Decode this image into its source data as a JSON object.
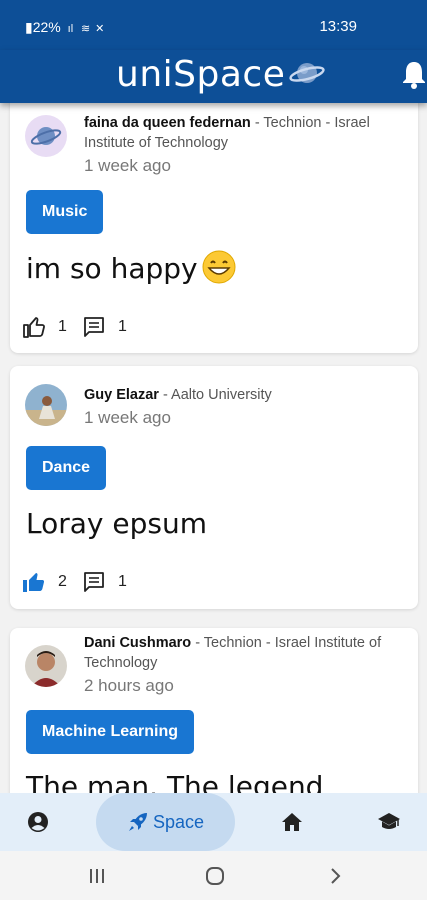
{
  "status": {
    "battery": "22%",
    "time": "13:39"
  },
  "header": {
    "title": "uniSpace"
  },
  "posts": [
    {
      "author": "faina da queen federnan",
      "affiliation": " - Technion - Israel Institute of Technology",
      "time": "1 week ago",
      "tag": "Music",
      "text": "im so happy",
      "likes": "1",
      "comments": "1",
      "liked": false
    },
    {
      "author": "Guy Elazar",
      "affiliation": " - Aalto University",
      "time": "1 week ago",
      "tag": "Dance",
      "text": "Loray epsum",
      "likes": "2",
      "comments": "1",
      "liked": true
    },
    {
      "author": "Dani Cushmaro",
      "affiliation": " - Technion - Israel Institute of Technology",
      "time": "2 hours ago",
      "tag": "Machine Learning",
      "text": "The man. The legend"
    }
  ],
  "nav": {
    "space_label": "Space",
    "active": "space"
  },
  "colors": {
    "primary": "#0d4f97",
    "tag": "#1976d2",
    "nav_bg": "#e3eef9",
    "nav_active": "#c5daf0"
  }
}
